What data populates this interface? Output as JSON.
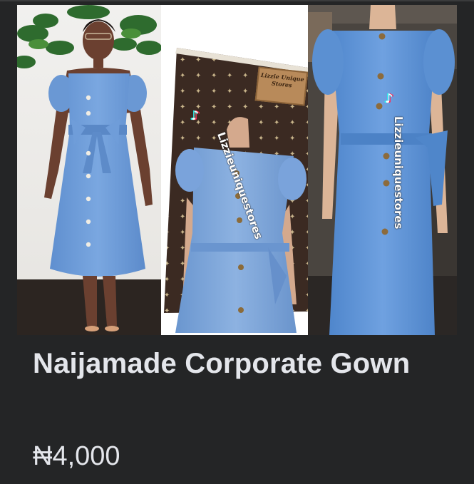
{
  "listing": {
    "title": "Naijamade Corporate Gown",
    "price": "₦4,000"
  },
  "image": {
    "watermark_left": "Lizzieuniquestores",
    "watermark_right": "Lizzieuniquestores",
    "sign_text": "Lizzie Unique Stores",
    "icon_names": [
      "tiktok-icon"
    ],
    "colors": {
      "background": "#242526",
      "text": "#e4e6eb",
      "dress_blue": "#6a98d4"
    }
  }
}
